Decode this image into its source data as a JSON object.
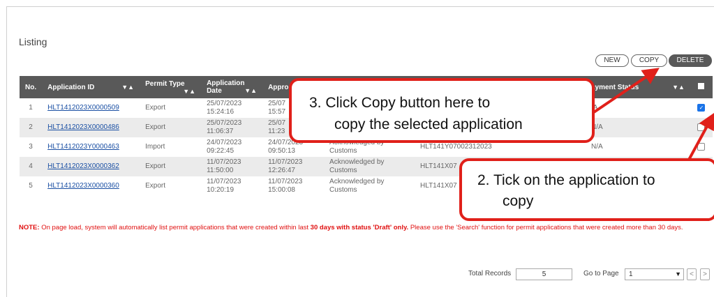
{
  "listing": {
    "title": "Listing"
  },
  "buttons": {
    "new": "NEW",
    "copy": "COPY",
    "delete": "DELETE"
  },
  "table": {
    "headers": {
      "no": "No.",
      "app_id": "Application ID",
      "permit_type": "Permit Type",
      "app_date_1": "Application",
      "app_date_2": "Date",
      "approval": "Appro",
      "payment_status": "ayment Status",
      "sort": "▼▲"
    },
    "rows": [
      {
        "no": "1",
        "id": "HLT1412023X0000509",
        "type": "Export",
        "date": "25/07/2023",
        "time": "15:24:16",
        "adate": "25/07",
        "atime": "15:57",
        "status": "",
        "permit": "",
        "pay": "/A",
        "checked": true
      },
      {
        "no": "2",
        "id": "HLT1412023X0000486",
        "type": "Export",
        "date": "25/07/2023",
        "time": "11:06:37",
        "adate": "25/07",
        "atime": "11:23",
        "status": "",
        "permit": "",
        "pay": "N/A",
        "checked": false
      },
      {
        "no": "3",
        "id": "HLT1412023Y0000463",
        "type": "Import",
        "date": "24/07/2023",
        "time": "09:22:45",
        "adate": "24/07/2023",
        "atime": "09:50:13",
        "status": "Acknowledged by Customs",
        "permit": "HLT141Y07002312023",
        "pay": "N/A",
        "checked": false
      },
      {
        "no": "4",
        "id": "HLT1412023X0000362",
        "type": "Export",
        "date": "11/07/2023",
        "time": "11:50:00",
        "adate": "11/07/2023",
        "atime": "12:26:47",
        "status": "Acknowledged by Customs",
        "permit": "HLT141X07",
        "pay": "",
        "checked": false
      },
      {
        "no": "5",
        "id": "HLT1412023X0000360",
        "type": "Export",
        "date": "11/07/2023",
        "time": "10:20:19",
        "adate": "11/07/2023",
        "atime": "15:00:08",
        "status": "Acknowledged by Customs",
        "permit": "HLT141X07",
        "pay": "",
        "checked": false
      }
    ]
  },
  "note": {
    "label": "NOTE:",
    "part1": " On page load, system will automatically list permit applications that were created within last ",
    "bold": "30 days with status 'Draft' only.",
    "part2": " Please use the 'Search' function for permit applications that were created more than 30 days."
  },
  "footer": {
    "total_label": "Total Records",
    "total_value": "5",
    "goto_label": "Go to Page",
    "page_value": "1",
    "prev": "<",
    "next": ">"
  },
  "callouts": {
    "copy_step": {
      "line1": "3.  Click Copy button here to",
      "line2": "copy the selected application"
    },
    "tick_step": {
      "line1": "2.  Tick on the application to",
      "line2": "copy"
    }
  },
  "colors": {
    "header_bg": "#595959",
    "callout_border": "#e0201a",
    "note_red": "#e01010",
    "link": "#1a4fa3"
  }
}
